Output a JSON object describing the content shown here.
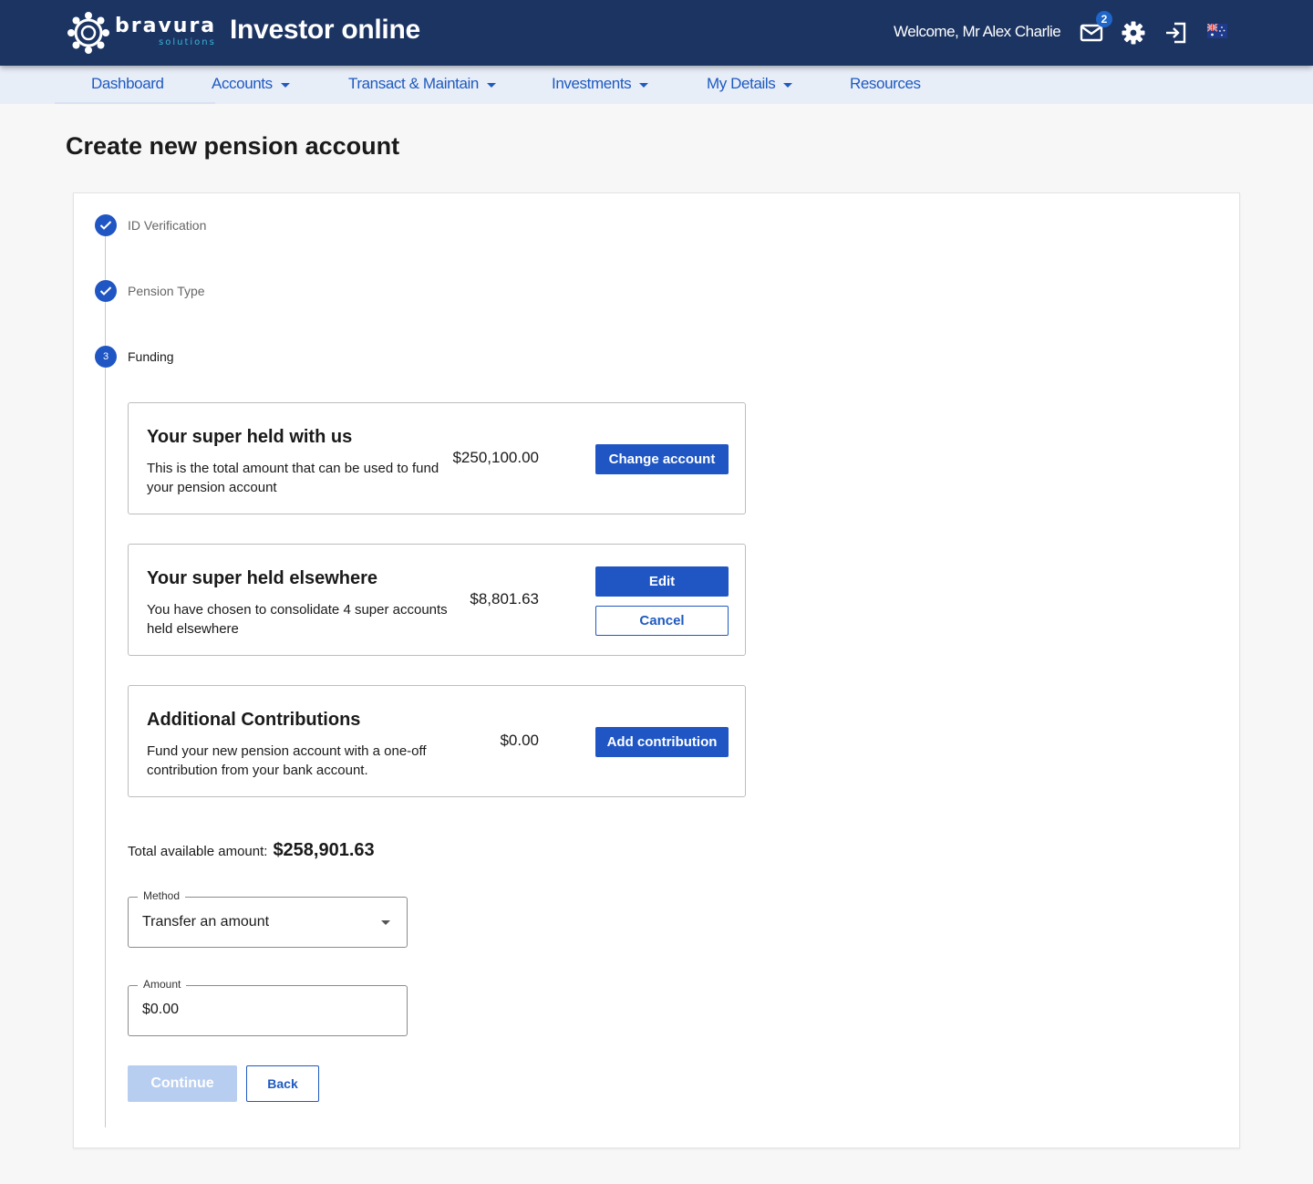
{
  "header": {
    "brand_name": "bravura",
    "brand_sub": "solutions",
    "app_title": "Investor online",
    "welcome": "Welcome, Mr Alex Charlie",
    "mail_count": "2",
    "icons": [
      "logo-icon",
      "mail-icon",
      "gear-icon",
      "logout-icon",
      "australia-flag-icon"
    ],
    "colors": {
      "header_bg": "#1c3462",
      "accent": "#1f56c4"
    }
  },
  "nav": {
    "items": [
      {
        "label": "Dashboard",
        "dropdown": false
      },
      {
        "label": "Accounts",
        "dropdown": true
      },
      {
        "label": "Transact & Maintain",
        "dropdown": true
      },
      {
        "label": "Investments",
        "dropdown": true
      },
      {
        "label": "My Details",
        "dropdown": true
      },
      {
        "label": "Resources",
        "dropdown": false
      }
    ]
  },
  "page": {
    "title": "Create new pension account"
  },
  "stepper": {
    "steps": [
      {
        "label": "ID Verification",
        "status": "complete"
      },
      {
        "label": "Pension Type",
        "status": "complete"
      },
      {
        "label": "Funding",
        "status": "active",
        "number": "3"
      }
    ]
  },
  "funding": {
    "super_with_us": {
      "title": "Your super held with us",
      "description": "This is the total amount that can be used to fund your pension account",
      "amount": "$250,100.00",
      "button": "Change account"
    },
    "super_elsewhere": {
      "title": "Your super held elsewhere",
      "description": "You have chosen to consolidate 4 super accounts held elsewhere",
      "amount": "$8,801.63",
      "edit_button": "Edit",
      "cancel_button": "Cancel"
    },
    "additional": {
      "title": "Additional Contributions",
      "description": "Fund your new pension account with a one-off contribution from your bank account.",
      "amount": "$0.00",
      "button": "Add contribution"
    },
    "total_label": "Total available amount:",
    "total_value": "$258,901.63"
  },
  "form": {
    "method_label": "Method",
    "method_value": "Transfer an amount",
    "amount_label": "Amount",
    "amount_value": "$0.00"
  },
  "actions": {
    "continue": "Continue",
    "back": "Back"
  }
}
